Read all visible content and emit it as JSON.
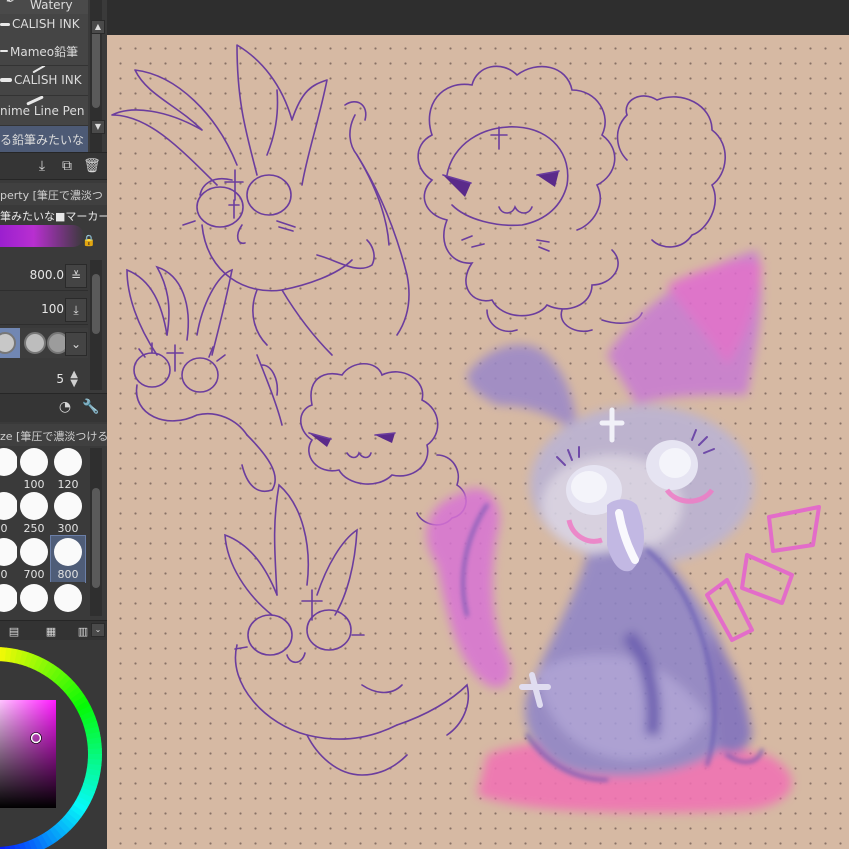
{
  "brush_list": {
    "items": [
      {
        "label": "Watery"
      },
      {
        "label": "CALISH INK"
      },
      {
        "label": "Mameo鉛筆"
      },
      {
        "label": "CALISH INK"
      },
      {
        "label": "nime Line Pen"
      },
      {
        "label": "る鉛筆みたいな"
      }
    ]
  },
  "tool_property": {
    "header": "perty [筆圧で濃淡つ",
    "brush_name": "筆みたいな■マーカー",
    "size_value": "800.0",
    "opacity_value": "100",
    "stabilization_value": "5"
  },
  "brush_size": {
    "header": "ze [筆圧で濃淡つける",
    "sizes": [
      "",
      "100",
      "120",
      "0",
      "250",
      "300",
      "0",
      "700",
      "800",
      "",
      "",
      ""
    ],
    "selected": "800"
  },
  "colors": {
    "accent": "#ff1aff",
    "selection": "#4f5d78",
    "canvas": "#d6b9a3",
    "sketch_line": "#6b3d9e"
  },
  "icons": [
    "export-icon",
    "duplicate-icon",
    "trash-icon",
    "pressure-icon",
    "download-icon",
    "chevron-down-icon",
    "dial-icon",
    "wrench-icon",
    "lock-icon"
  ]
}
